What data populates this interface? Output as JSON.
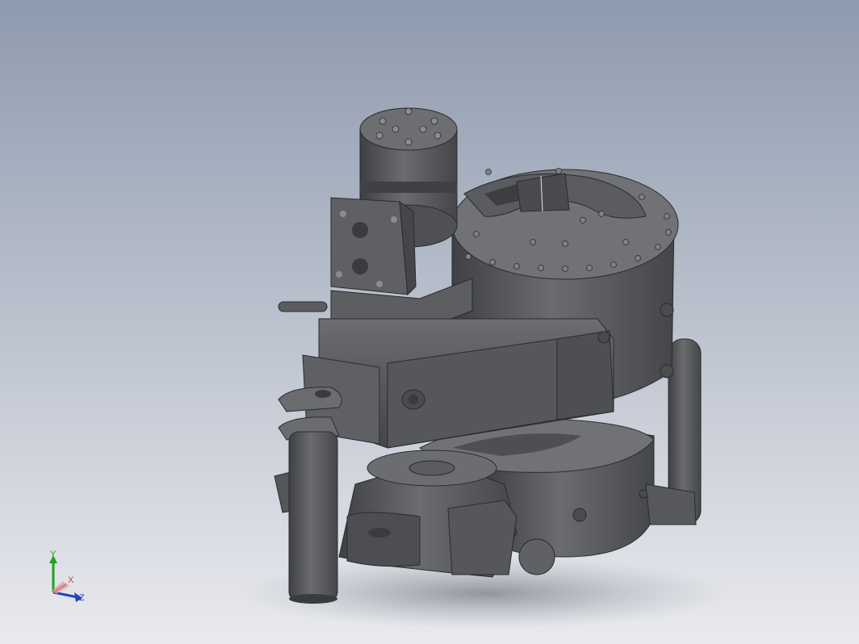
{
  "viewport": {
    "background_top": "#8e9aae",
    "background_bottom": "#e9eaee",
    "model_color": "#5a5c60"
  },
  "triad": {
    "y_label": "Y",
    "x_label": "X",
    "z_label": "Z",
    "y_color": "#1fa31f",
    "x_color": "#d03a3a",
    "z_color": "#2a3fbf"
  }
}
